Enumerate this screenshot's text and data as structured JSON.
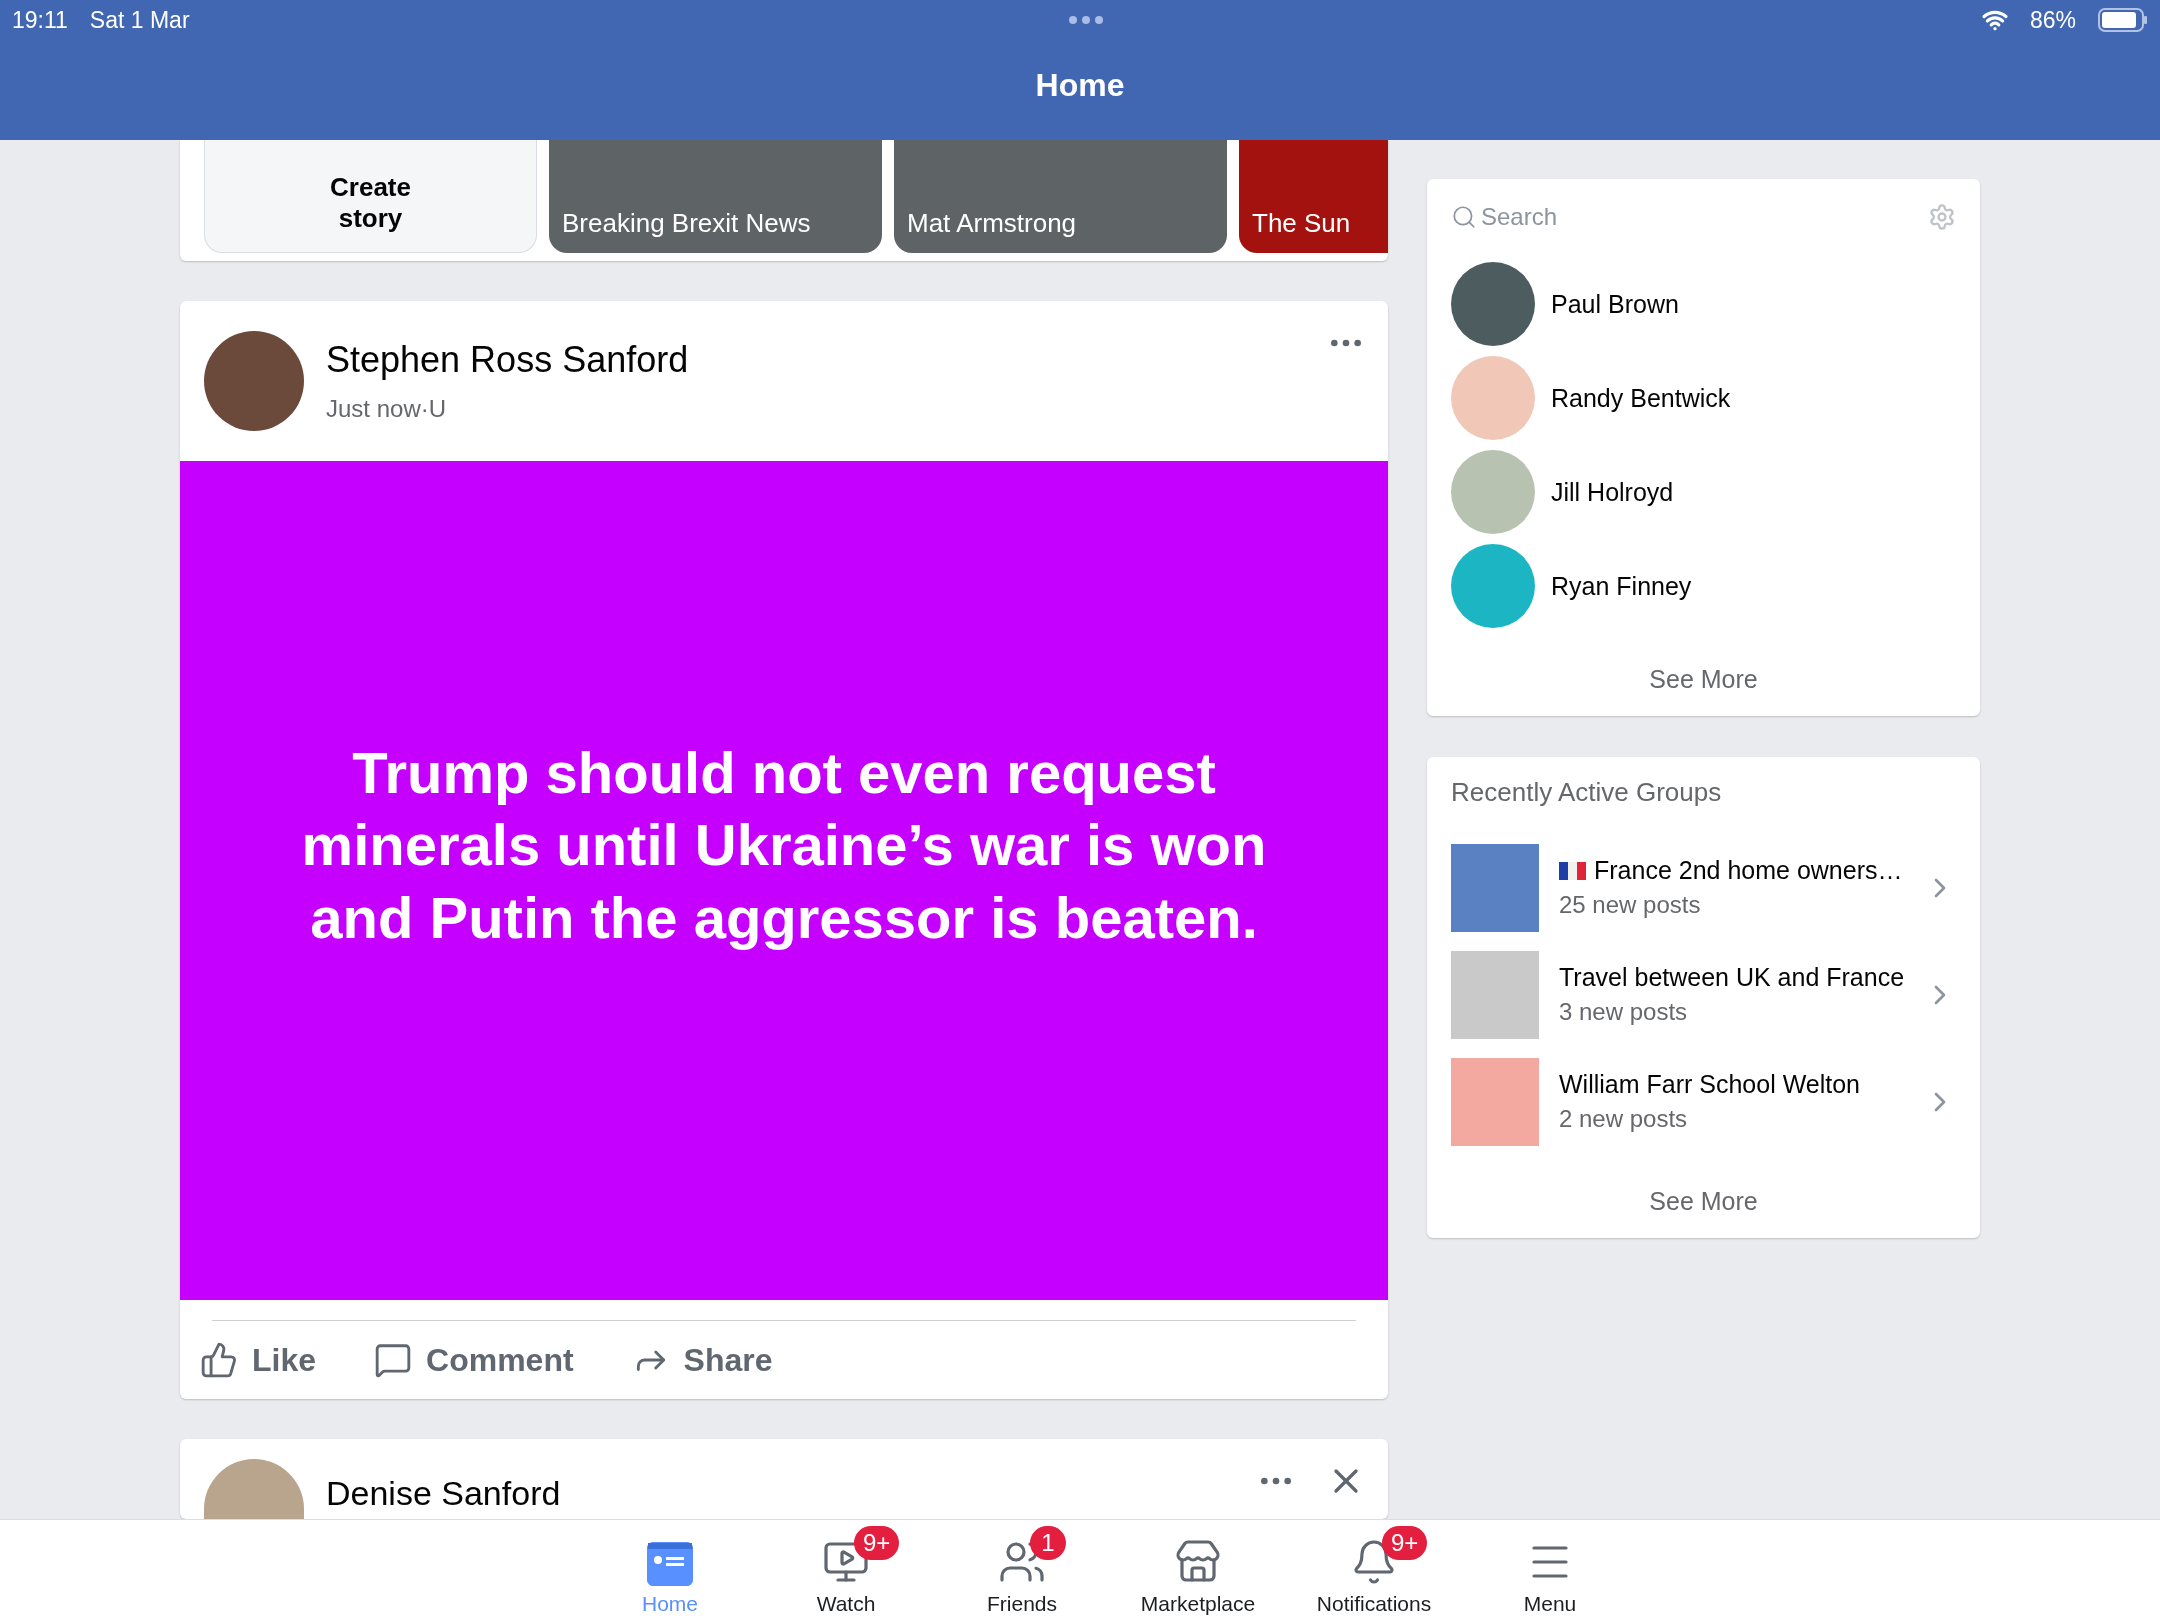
{
  "status_bar": {
    "time": "19:11",
    "date": "Sat 1 Mar",
    "battery": "86%"
  },
  "header": {
    "title": "Home"
  },
  "stories": [
    {
      "kind": "create",
      "label": "Create\nstory"
    },
    {
      "kind": "story",
      "label": "Breaking Brexit News",
      "color": "#5e6466"
    },
    {
      "kind": "story",
      "label": "Mat Armstrong",
      "color": "#5e6466"
    },
    {
      "kind": "story",
      "label": "The Sun",
      "color": "#a3120e"
    }
  ],
  "post": {
    "author": "Stephen Ross Sanford",
    "meta": "Just now·U",
    "text": "Trump should not even request minerals until Ukraine’s war is won and Putin the aggressor is beaten.",
    "actions": [
      {
        "kind": "like",
        "label": "Like"
      },
      {
        "kind": "comment",
        "label": "Comment"
      },
      {
        "kind": "share",
        "label": "Share"
      }
    ]
  },
  "next_post": {
    "author": "Denise Sanford"
  },
  "contacts": {
    "search": {
      "placeholder": "Search"
    },
    "items": [
      {
        "name": "Paul Brown"
      },
      {
        "name": "Randy Bentwick"
      },
      {
        "name": "Jill Holroyd"
      },
      {
        "name": "Ryan Finney"
      }
    ],
    "see_more": "See More"
  },
  "groups": {
    "title": "Recently Active Groups",
    "items": [
      {
        "name": "France 2nd home owners…",
        "posts": "25 new posts",
        "flag": true
      },
      {
        "name": "Travel between UK and France",
        "posts": "3 new posts",
        "flag": false
      },
      {
        "name": "William Farr School Welton",
        "posts": "2 new posts",
        "flag": false
      }
    ],
    "see_more": "See More"
  },
  "tabs": [
    {
      "kind": "home",
      "label": "Home",
      "selected": true
    },
    {
      "kind": "watch",
      "label": "Watch",
      "selected": false,
      "badge": "9+"
    },
    {
      "kind": "friends",
      "label": "Friends",
      "selected": false,
      "badge": "1"
    },
    {
      "kind": "marketplace",
      "label": "Marketplace",
      "selected": false
    },
    {
      "kind": "notifications",
      "label": "Notifications",
      "selected": false,
      "badge": "9+"
    },
    {
      "kind": "menu",
      "label": "Menu",
      "selected": false
    }
  ]
}
